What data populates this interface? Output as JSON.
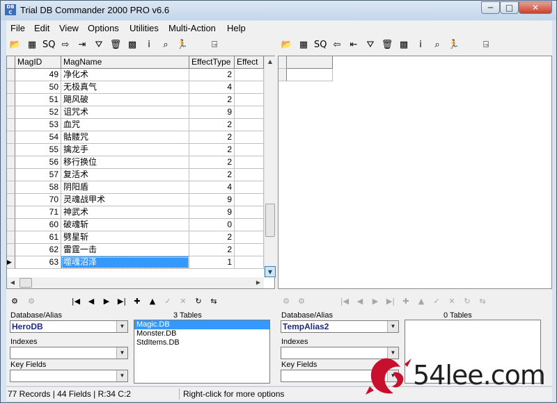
{
  "title": "Trial DB Commander 2000 PRO v6.6",
  "app_icon_text": "DB C",
  "window_buttons": {
    "minimize": "─",
    "maximize": "□",
    "close": "✕"
  },
  "menu": [
    "File",
    "Edit",
    "View",
    "Options",
    "Utilities",
    "Multi-Action",
    "Help"
  ],
  "left_toolbar_icons": [
    {
      "name": "open-folder-icon",
      "glyph": "📂"
    },
    {
      "name": "table-icon",
      "glyph": "▦"
    },
    {
      "name": "sql-icon",
      "glyph": "SQ"
    },
    {
      "name": "export-arrow-icon",
      "glyph": "⇨"
    },
    {
      "name": "import-icon",
      "glyph": "⇥"
    },
    {
      "name": "filter-icon",
      "glyph": "⛛"
    },
    {
      "name": "trash-icon",
      "glyph": "🗑"
    },
    {
      "name": "batch-icon",
      "glyph": "▩"
    },
    {
      "name": "info-icon",
      "glyph": "i"
    },
    {
      "name": "find-icon",
      "glyph": "⌕"
    },
    {
      "name": "run-icon",
      "glyph": "🏃"
    },
    {
      "name": "exit-icon",
      "glyph": "⍈"
    }
  ],
  "right_toolbar_icons": [
    {
      "name": "open-folder-icon",
      "glyph": "📂"
    },
    {
      "name": "table-icon",
      "glyph": "▦"
    },
    {
      "name": "sql-icon",
      "glyph": "SQ"
    },
    {
      "name": "export-arrow-icon",
      "glyph": "⇦"
    },
    {
      "name": "import-icon",
      "glyph": "⇤"
    },
    {
      "name": "filter-icon",
      "glyph": "⛛"
    },
    {
      "name": "trash-icon",
      "glyph": "🗑"
    },
    {
      "name": "batch-icon",
      "glyph": "▩"
    },
    {
      "name": "info-icon",
      "glyph": "i"
    },
    {
      "name": "find-icon",
      "glyph": "⌕"
    },
    {
      "name": "run-icon",
      "glyph": "🏃"
    },
    {
      "name": "exit-icon",
      "glyph": "⍈"
    }
  ],
  "grid": {
    "columns": [
      "MagID",
      "MagName",
      "EffectType",
      "Effect"
    ],
    "rows": [
      {
        "id": "49",
        "name": "净化术",
        "type": "2"
      },
      {
        "id": "50",
        "name": "无极真气",
        "type": "4"
      },
      {
        "id": "51",
        "name": "飓风破",
        "type": "2"
      },
      {
        "id": "52",
        "name": "诅咒术",
        "type": "9"
      },
      {
        "id": "53",
        "name": "血咒",
        "type": "2"
      },
      {
        "id": "54",
        "name": "骷髅咒",
        "type": "2"
      },
      {
        "id": "55",
        "name": "擒龙手",
        "type": "2"
      },
      {
        "id": "56",
        "name": "移行换位",
        "type": "2"
      },
      {
        "id": "57",
        "name": "复活术",
        "type": "2"
      },
      {
        "id": "58",
        "name": "阴阳盾",
        "type": "4"
      },
      {
        "id": "70",
        "name": "灵魂战甲术",
        "type": "9"
      },
      {
        "id": "71",
        "name": "神武术",
        "type": "9"
      },
      {
        "id": "60",
        "name": "破魂斩",
        "type": "0"
      },
      {
        "id": "61",
        "name": "劈星斩",
        "type": "2"
      },
      {
        "id": "62",
        "name": "雷霆一击",
        "type": "2"
      },
      {
        "id": "63",
        "name": "噬魂沼泽",
        "type": "1"
      }
    ],
    "selected_row": 15
  },
  "left_panel": {
    "db_label": "Database/Alias",
    "db_value": "HeroDB",
    "indexes_label": "Indexes",
    "indexes_value": "",
    "keyfields_label": "Key Fields",
    "keyfields_value": "",
    "tables_count": "3 Tables",
    "tables": [
      "Magic.DB",
      "Monster.DB",
      "StdItems.DB"
    ],
    "selected_table": 0
  },
  "right_panel": {
    "db_label": "Database/Alias",
    "db_value": "TempAlias2",
    "indexes_label": "Indexes",
    "indexes_value": "",
    "keyfields_label": "Key Fields",
    "keyfields_value": "",
    "tables_count": "0 Tables",
    "tables": []
  },
  "nav_buttons": [
    "|◀",
    "◀",
    "▶",
    "▶|",
    "✚",
    "▲",
    "✓",
    "✕",
    "↻",
    "⇆"
  ],
  "status": {
    "records": "77 Records | 44 Fields | R:34 C:2",
    "hint": "Right-click for more options"
  },
  "watermark": {
    "text": "54lee.com",
    "colors": {
      "logo": "#c8102e",
      "text": "#1f1f1f"
    }
  }
}
